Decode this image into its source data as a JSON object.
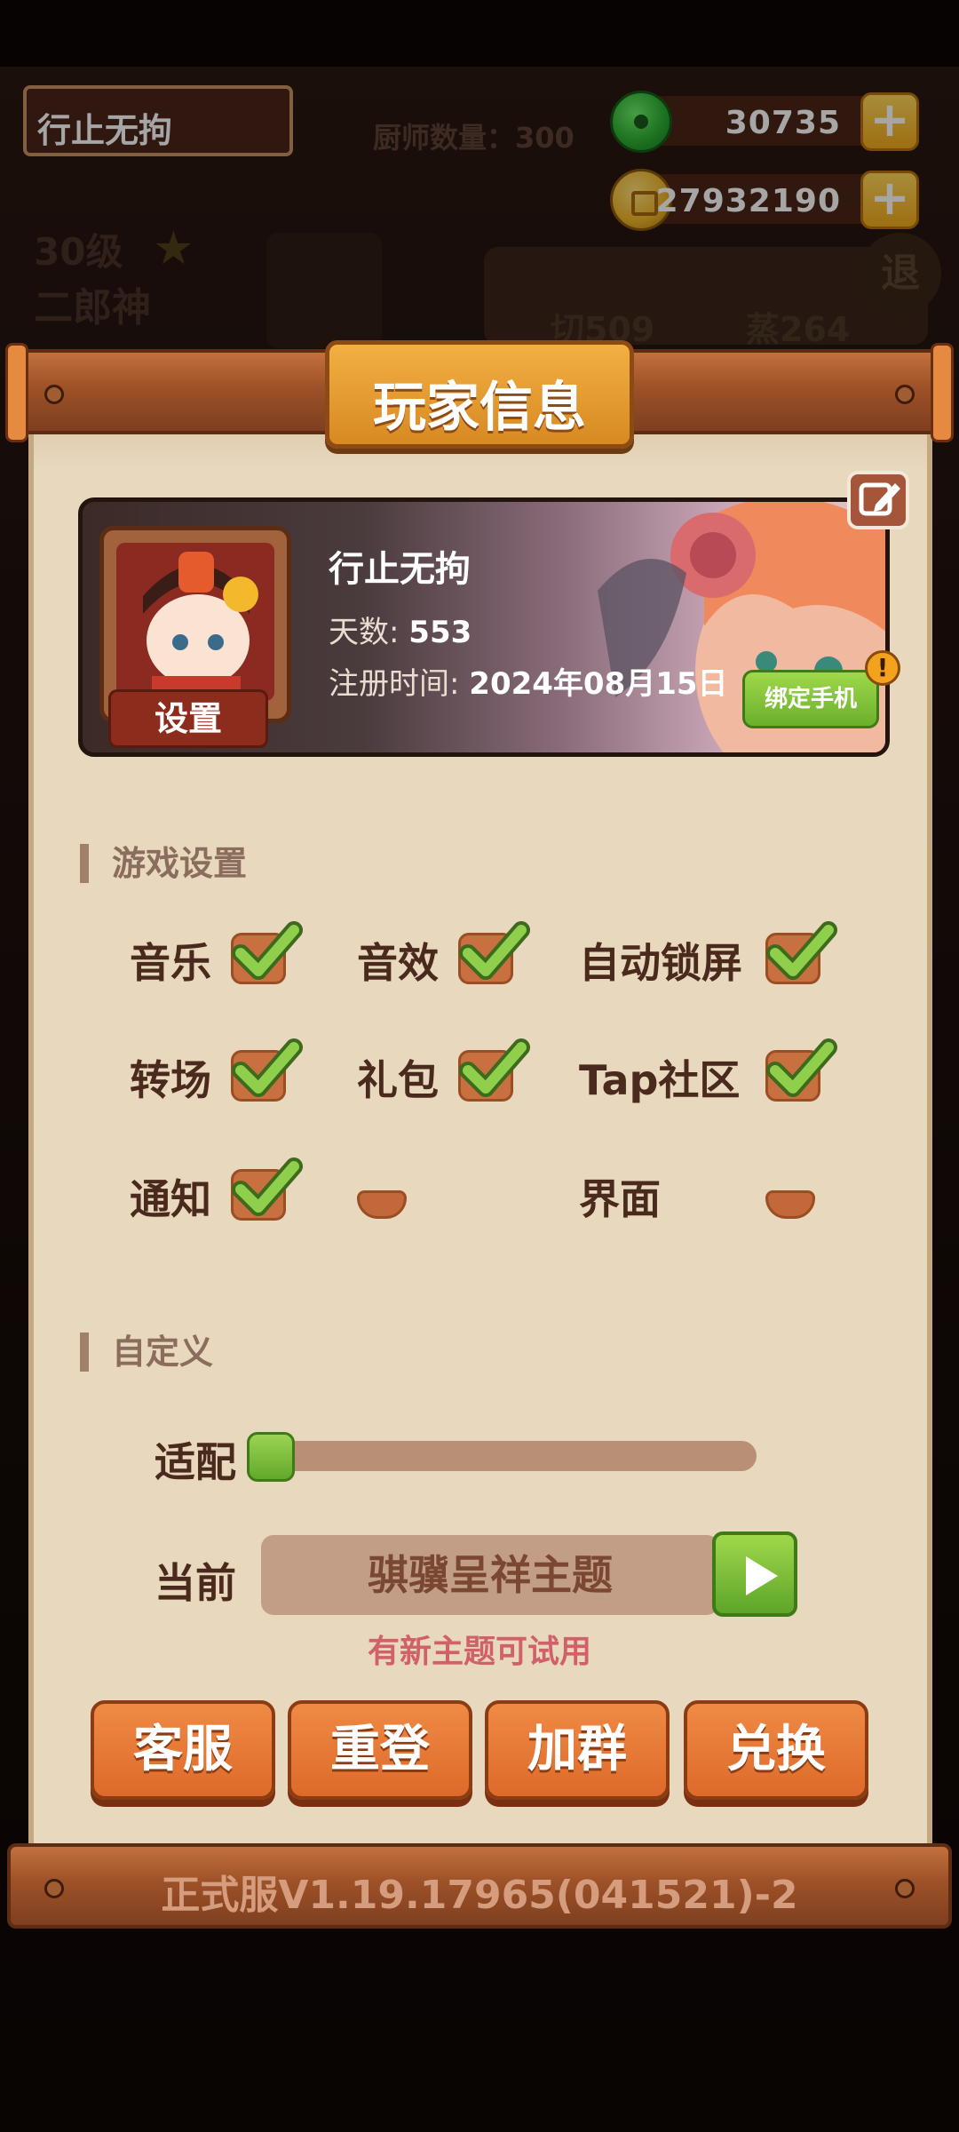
{
  "background": {
    "player_name": "行止无拘",
    "chef_count": "厨师数量：300",
    "level": "30级",
    "god_name": "二郎神",
    "stat_qie": "切509",
    "stat_zheng": "蒸264",
    "exit_label": "退"
  },
  "currency": {
    "jade": "30735",
    "gold": "27932190",
    "plus": "+"
  },
  "dialog": {
    "title": "玩家信息",
    "profile": {
      "name": "行止无拘",
      "days_label": "天数:",
      "days_value": "553",
      "reg_label": "注册时间:",
      "reg_value": "2024年08月15日",
      "settings_tab": "设置",
      "bind_phone": "绑定手机",
      "alert": "!"
    },
    "game_settings": {
      "header": "游戏设置",
      "items": [
        {
          "label": "音乐",
          "checked": true
        },
        {
          "label": "音效",
          "checked": true
        },
        {
          "label": "自动锁屏",
          "checked": true
        },
        {
          "label": "转场",
          "checked": true
        },
        {
          "label": "礼包",
          "checked": true
        },
        {
          "label": "Tap社区",
          "checked": true
        },
        {
          "label": "通知",
          "checked": true
        },
        {
          "label": "",
          "checked": false
        },
        {
          "label": "界面",
          "checked": false
        }
      ]
    },
    "custom": {
      "header": "自定义",
      "fit_label": "适配",
      "fit_value": 0,
      "current_label": "当前",
      "theme_name": "骐骥呈祥主题",
      "theme_hint": "有新主题可试用"
    },
    "buttons": [
      "客服",
      "重登",
      "加群",
      "兑换"
    ],
    "version": "正式服V1.19.17965(041521)-2"
  },
  "colors": {
    "panel": "#e8d8be",
    "wood": "#9d5128",
    "accent_orange": "#dd6a2a",
    "check_green": "#6ab02b",
    "hint_red": "#d0606a"
  }
}
